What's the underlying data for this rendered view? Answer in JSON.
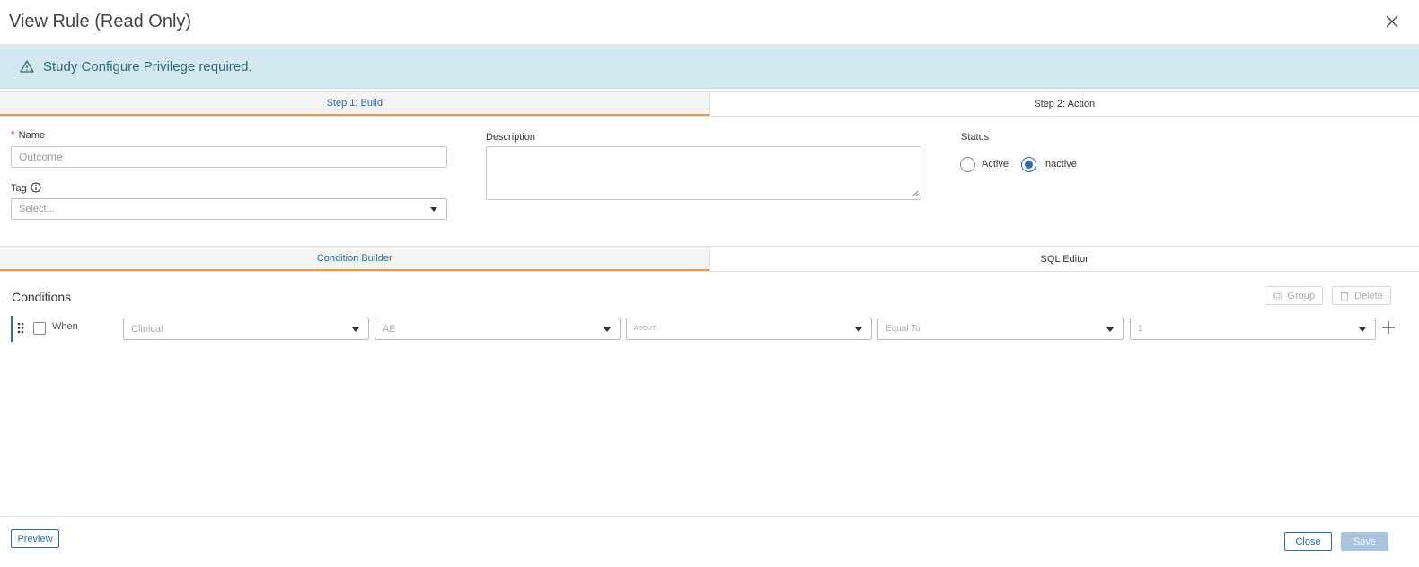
{
  "header": {
    "title": "View Rule (Read Only)",
    "close_icon": "close-icon"
  },
  "alert": {
    "icon": "warning-triangle-icon",
    "text": "Study Configure Privilege required.",
    "color": "#d3e9ef"
  },
  "steps": [
    {
      "label": "Step 1: Build",
      "active": true
    },
    {
      "label": "Step 2: Action",
      "active": false
    }
  ],
  "form": {
    "name": {
      "label": "Name",
      "required_marker": "*",
      "placeholder": "Outcome"
    },
    "tag": {
      "label": "Tag",
      "info_icon": "info-icon",
      "placeholder": "Select..."
    },
    "description": {
      "label": "Description",
      "value": ""
    },
    "status": {
      "label": "Status",
      "options": [
        {
          "label": "Active",
          "checked": false
        },
        {
          "label": "Inactive",
          "checked": true
        }
      ]
    }
  },
  "builder_tabs": [
    {
      "label": "Condition Builder",
      "active": true
    },
    {
      "label": "SQL Editor",
      "active": false
    }
  ],
  "conditions": {
    "title": "Conditions",
    "group_label": "Group",
    "delete_label": "Delete",
    "row": {
      "when_label": "When",
      "fields": [
        "Clinical",
        "AE",
        "AEOUT",
        "Equal To",
        "1"
      ]
    }
  },
  "footer": {
    "preview_label": "Preview",
    "close_label": "Close",
    "save_label": "Save"
  },
  "colors": {
    "accent": "#2c6ea8",
    "tab_underline": "#e89a4c"
  }
}
